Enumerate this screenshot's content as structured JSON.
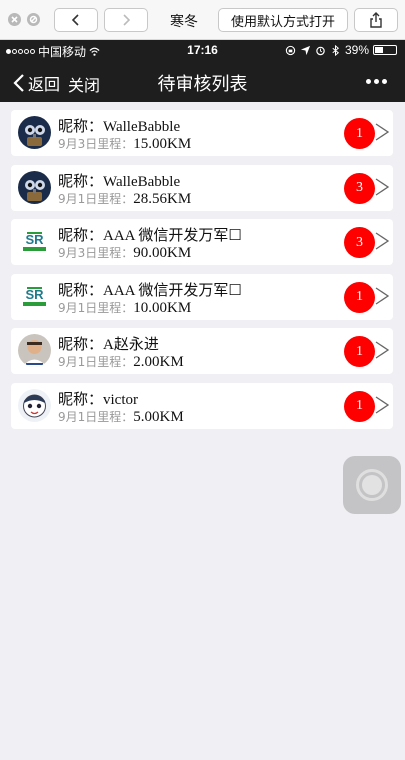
{
  "simulator": {
    "title": "寒冬",
    "open_default_label": "使用默认方式打开"
  },
  "status_bar": {
    "carrier": "中国移动",
    "time": "17:16",
    "battery": "39%",
    "battery_level": 0.39
  },
  "header": {
    "back_label": "返回",
    "close_label": "关闭",
    "title": "待审核列表"
  },
  "colors": {
    "badge": "#ff0000",
    "header_bg": "#1e1e1e",
    "page_bg": "#efeff4"
  },
  "items": [
    {
      "name_prefix": "昵称：",
      "name": "WalleBabble",
      "date_label": "9月3日里程：",
      "distance": "15.00KM",
      "count": "1",
      "avatar": "robot-avatar"
    },
    {
      "name_prefix": "昵称：",
      "name": "WalleBabble",
      "date_label": "9月1日里程：",
      "distance": "28.56KM",
      "count": "3",
      "avatar": "robot-avatar"
    },
    {
      "name_prefix": "昵称：",
      "name": "AAA 微信开发万军☐",
      "date_label": "9月3日里程：",
      "distance": "90.00KM",
      "count": "3",
      "avatar": "logo-avatar"
    },
    {
      "name_prefix": "昵称：",
      "name": "AAA 微信开发万军☐",
      "date_label": "9月1日里程：",
      "distance": "10.00KM",
      "count": "1",
      "avatar": "logo-avatar"
    },
    {
      "name_prefix": "昵称：",
      "name": "A赵永进",
      "date_label": "9月1日里程：",
      "distance": "2.00KM",
      "count": "1",
      "avatar": "person-avatar"
    },
    {
      "name_prefix": "昵称：",
      "name": "victor",
      "date_label": "9月1日里程：",
      "distance": "5.00KM",
      "count": "1",
      "avatar": "cartoon-avatar"
    }
  ]
}
